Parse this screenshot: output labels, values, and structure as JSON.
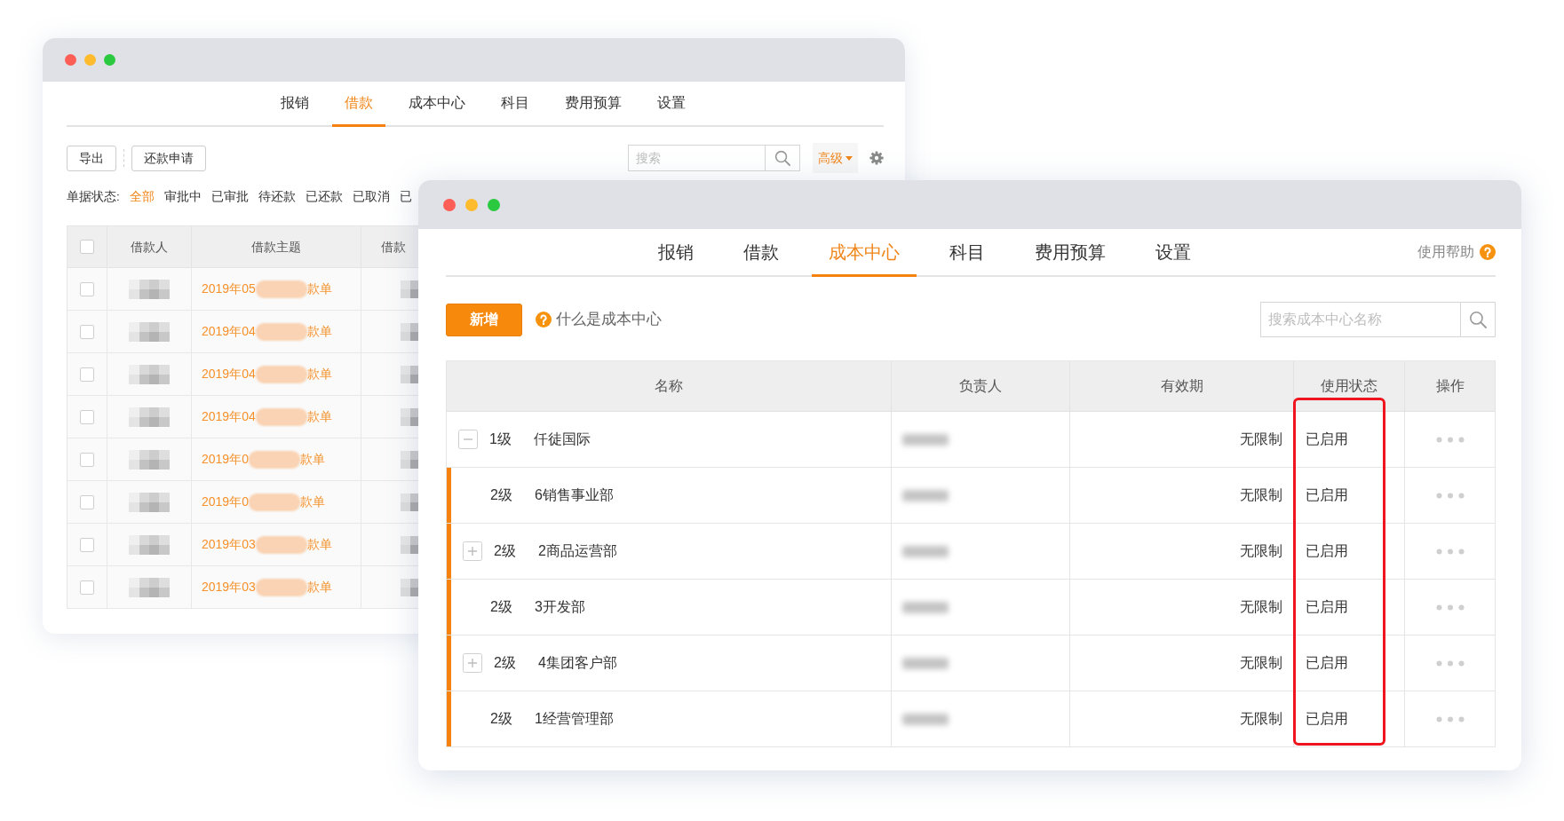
{
  "back_window": {
    "tabs": [
      {
        "label": "报销",
        "selected": false
      },
      {
        "label": "借款",
        "selected": true
      },
      {
        "label": "成本中心",
        "selected": false
      },
      {
        "label": "科目",
        "selected": false
      },
      {
        "label": "费用预算",
        "selected": false
      },
      {
        "label": "设置",
        "selected": false
      }
    ],
    "toolbar": {
      "buttons": [
        "导出",
        "还款申请"
      ],
      "search": {
        "placeholder": "搜索"
      },
      "advanced": "高级"
    },
    "filter": {
      "label": "单据状态:",
      "options": [
        {
          "label": "全部",
          "selected": true
        },
        {
          "label": "审批中",
          "selected": false
        },
        {
          "label": "已审批",
          "selected": false
        },
        {
          "label": "待还款",
          "selected": false
        },
        {
          "label": "已还款",
          "selected": false
        },
        {
          "label": "已取消",
          "selected": false
        },
        {
          "label": "已",
          "selected": false
        }
      ]
    },
    "table": {
      "select_all_checked": false,
      "columns": [
        "借款人",
        "借款主题",
        "借款"
      ],
      "rows": [
        {
          "checked": false,
          "subject_start": "2019年05",
          "subject_end": "款单"
        },
        {
          "checked": false,
          "subject_start": "2019年04",
          "subject_end": "款单"
        },
        {
          "checked": false,
          "subject_start": "2019年04",
          "subject_end": "款单"
        },
        {
          "checked": false,
          "subject_start": "2019年04",
          "subject_end": "款单"
        },
        {
          "checked": false,
          "subject_start": "2019年0",
          "subject_end": "款单"
        },
        {
          "checked": false,
          "subject_start": "2019年0",
          "subject_end": "款单"
        },
        {
          "checked": false,
          "subject_start": "2019年03",
          "subject_end": "款单"
        },
        {
          "checked": false,
          "subject_start": "2019年03",
          "subject_end": "款单"
        }
      ]
    }
  },
  "front_window": {
    "tabs": [
      {
        "label": "报销",
        "selected": false
      },
      {
        "label": "借款",
        "selected": false
      },
      {
        "label": "成本中心",
        "selected": true
      },
      {
        "label": "科目",
        "selected": false
      },
      {
        "label": "费用预算",
        "selected": false
      },
      {
        "label": "设置",
        "selected": false
      }
    ],
    "help": "使用帮助",
    "add_button": "新增",
    "help_link": "什么是成本中心",
    "search": {
      "placeholder": "搜索成本中心名称"
    },
    "table": {
      "columns": [
        {
          "label": "名称",
          "highlighted": false
        },
        {
          "label": "负责人",
          "highlighted": false
        },
        {
          "label": "有效期",
          "highlighted": false
        },
        {
          "label": "使用状态",
          "highlighted": true
        },
        {
          "label": "操作",
          "highlighted": false
        }
      ],
      "rows": [
        {
          "kind": "branch",
          "expanded": true,
          "tier": "1级",
          "name": "仟徒国际",
          "validity": "无限制",
          "status": "已启用",
          "children": [
            {
              "kind": "leaf",
              "tier": "2级",
              "name": "6销售事业部",
              "validity": "无限制",
              "status": "已启用"
            },
            {
              "kind": "branch",
              "expanded": false,
              "tier": "2级",
              "name": "2商品运营部",
              "validity": "无限制",
              "status": "已启用"
            },
            {
              "kind": "leaf",
              "tier": "2级",
              "name": "3开发部",
              "validity": "无限制",
              "status": "已启用"
            },
            {
              "kind": "branch",
              "expanded": false,
              "tier": "2级",
              "name": "4集团客户部",
              "validity": "无限制",
              "status": "已启用"
            },
            {
              "kind": "leaf",
              "tier": "2级",
              "name": "1经营管理部",
              "validity": "无限制",
              "status": "已启用"
            }
          ]
        }
      ]
    }
  }
}
